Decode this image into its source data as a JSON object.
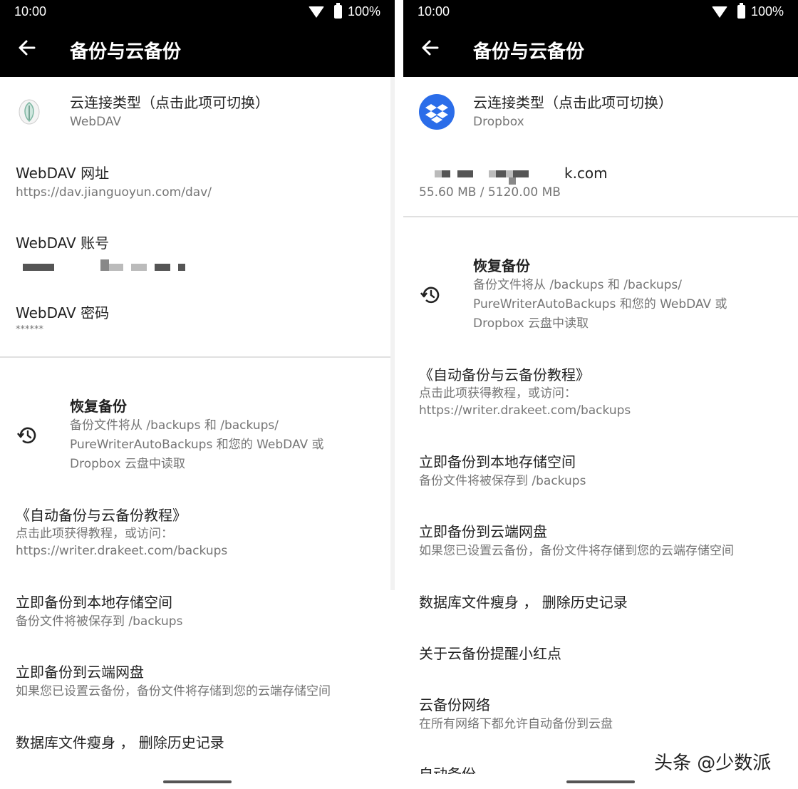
{
  "status": {
    "time": "10:00",
    "battery": "100%"
  },
  "title": "备份与云备份",
  "left": {
    "cloud_type": {
      "title": "云连接类型（点击此项可切换）",
      "value": "WebDAV"
    },
    "webdav_url": {
      "title": "WebDAV 网址",
      "value": "https://dav.jianguoyun.com/dav/"
    },
    "webdav_account": {
      "title": "WebDAV 账号"
    },
    "webdav_password": {
      "title": "WebDAV 密码",
      "value": "******"
    },
    "restore": {
      "title": "恢复备份",
      "line1": "备份文件将从 /backups 和 /backups/",
      "line2": "PureWriterAutoBackups 和您的 WebDAV 或",
      "line3": "Dropbox 云盘中读取"
    },
    "tutorial": {
      "title": "《自动备份与云备份教程》",
      "line1": "点击此项获得教程，或访问：",
      "line2": "https://writer.drakeet.com/backups"
    },
    "backup_local": {
      "title": "立即备份到本地存储空间",
      "value": "备份文件将被保存到 /backups"
    },
    "backup_cloud": {
      "title": "立即备份到云端网盘",
      "value": "如果您已设置云备份，备份文件将存储到您的云端存储空间"
    },
    "slim_db": {
      "title": "数据库文件瘦身 ， 删除历史记录"
    }
  },
  "right": {
    "cloud_type": {
      "title": "云连接类型（点击此项可切换）",
      "value": "Dropbox"
    },
    "account": {
      "email_suffix": "k.com",
      "usage": "55.60 MB / 5120.00 MB"
    },
    "restore": {
      "title": "恢复备份",
      "line1": "备份文件将从 /backups 和 /backups/",
      "line2": "PureWriterAutoBackups 和您的 WebDAV 或",
      "line3": "Dropbox 云盘中读取"
    },
    "tutorial": {
      "title": "《自动备份与云备份教程》",
      "line1": "点击此项获得教程，或访问：",
      "line2": "https://writer.drakeet.com/backups"
    },
    "backup_local": {
      "title": "立即备份到本地存储空间",
      "value": "备份文件将被保存到 /backups"
    },
    "backup_cloud": {
      "title": "立即备份到云端网盘",
      "value": "如果您已设置云备份，备份文件将存储到您的云端存储空间"
    },
    "slim_db": {
      "title": "数据库文件瘦身 ， 删除历史记录"
    },
    "red_dot": {
      "title": "关于云备份提醒小红点"
    },
    "network": {
      "title": "云备份网络",
      "value": "在所有网络下都允许自动备份到云盘"
    },
    "auto_backup_partial": {
      "title": "自动备份"
    }
  },
  "watermark": "头条 @少数派",
  "colors": {
    "topbar": "#000000",
    "dropbox": "#2b6de9",
    "secondary_text": "#757575"
  },
  "icons": [
    "back-arrow-icon",
    "wifi-icon",
    "battery-icon",
    "webdav-app-icon",
    "dropbox-icon",
    "history-icon"
  ]
}
